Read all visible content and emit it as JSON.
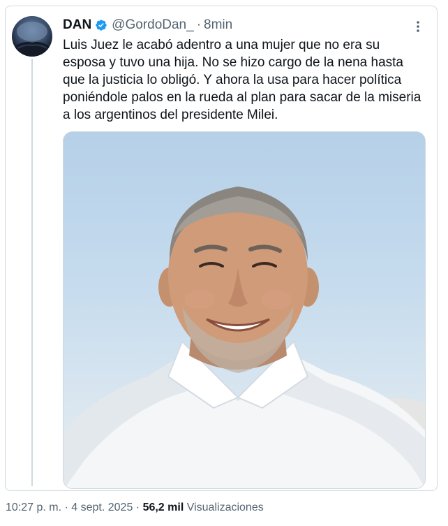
{
  "author": {
    "name": "DAN",
    "handle": "@GordoDan_",
    "separator": "·",
    "time": "8min"
  },
  "tweet": {
    "text": "Luis Juez le acabó adentro a una mujer que no era su esposa y tuvo una hija. No se hizo cargo de la nena hasta que la justicia lo obligó. Y ahora la usa para hacer política poniéndole palos en la rueda al plan para sacar de la miseria a los argentinos del presidente Milei."
  },
  "meta": {
    "timestamp": "10:27 p. m. · 4 sept. 2025 ·",
    "views_count": "56,2 mil",
    "views_label": "Visualizaciones"
  },
  "colors": {
    "verified_badge": "#1d9bf0",
    "secondary_text": "#536471",
    "border": "#cfd9de"
  },
  "icons": {
    "verified": "verified-badge-icon",
    "more": "more-options-icon"
  }
}
